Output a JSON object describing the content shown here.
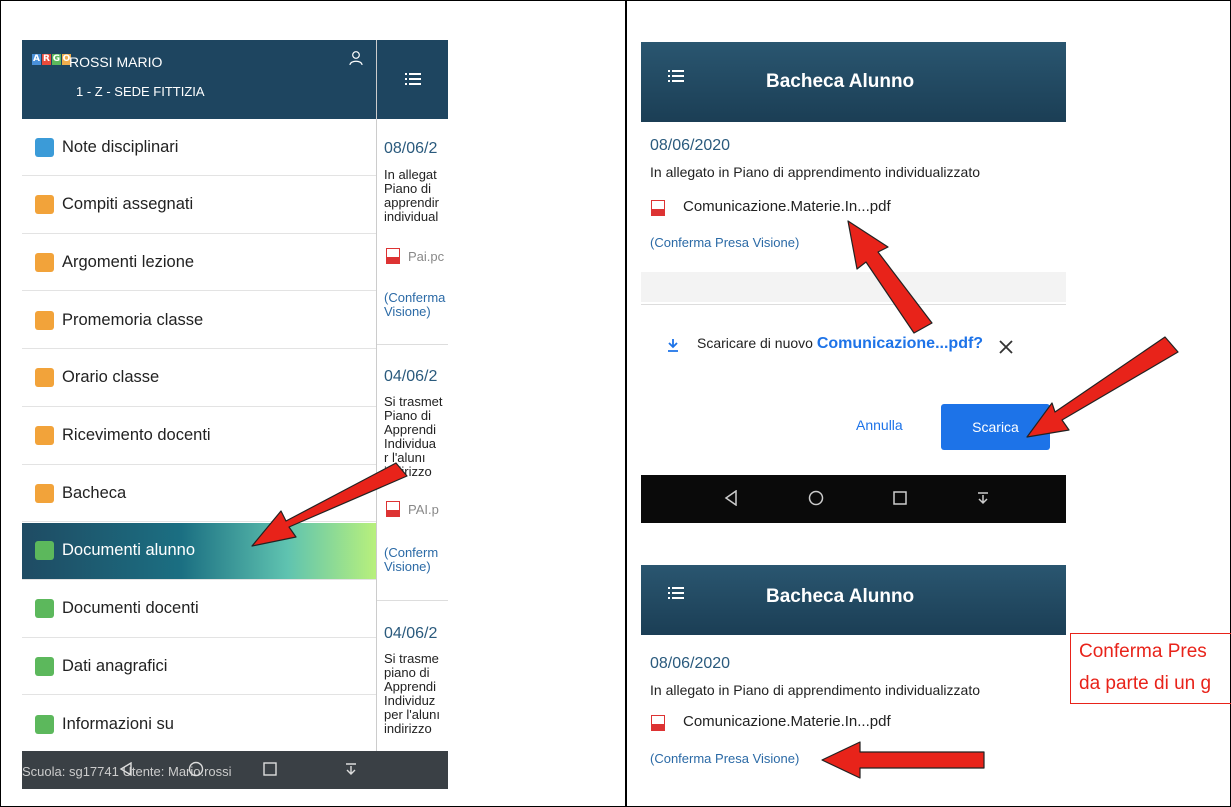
{
  "left_phone": {
    "app_logo_letters": [
      "A",
      "R",
      "G",
      "O"
    ],
    "user_name": "ROSSI MARIO",
    "user_class": "1 - Z - SEDE FITTIZIA",
    "menu": [
      {
        "label": "Note disciplinari",
        "icon": "notes-icon",
        "color": "#3b9bd8"
      },
      {
        "label": "Compiti assegnati",
        "icon": "homework-icon",
        "color": "#f2a33a"
      },
      {
        "label": "Argomenti lezione",
        "icon": "lesson-topics-icon",
        "color": "#f2a33a"
      },
      {
        "label": "Promemoria classe",
        "icon": "reminder-icon",
        "color": "#f2a33a"
      },
      {
        "label": "Orario classe",
        "icon": "timetable-icon",
        "color": "#f2a33a"
      },
      {
        "label": "Ricevimento docenti",
        "icon": "teacher-meeting-icon",
        "color": "#f2a33a"
      },
      {
        "label": "Bacheca",
        "icon": "noticeboard-icon",
        "color": "#f2a33a"
      },
      {
        "label": "Documenti alunno",
        "icon": "student-documents-icon",
        "color": "#5cb85c",
        "active": true
      },
      {
        "label": "Documenti docenti",
        "icon": "teacher-documents-icon",
        "color": "#5cb85c"
      },
      {
        "label": "Dati anagrafici",
        "icon": "personal-data-icon",
        "color": "#5cb85c"
      },
      {
        "label": "Informazioni su",
        "icon": "info-icon",
        "color": "#5cb85c"
      }
    ],
    "status_bar": "Scuola: sg17741 Utente: Mario.rossi",
    "peek": {
      "date1": "08/06/2",
      "text1": [
        "In allegat",
        "Piano di",
        "apprendir",
        "individual"
      ],
      "file1": "Pai.pc",
      "link1": [
        "(Conferma",
        "Visione)"
      ],
      "date2": "04/06/2",
      "text2": [
        "Si trasmet",
        "Piano di",
        "Apprendi",
        "Individua",
        "r l'alunı",
        "indirizzo"
      ],
      "file2": "PAI.p",
      "link2": [
        "(Conferm",
        "Visione)"
      ],
      "date3": "04/06/2",
      "text3": [
        "Si trasme",
        "piano di",
        "Apprendi",
        "Individuz",
        "per l'alunı",
        "indirizzo"
      ]
    }
  },
  "top_right": {
    "header_title": "Bacheca Alunno",
    "date": "08/06/2020",
    "text": "In allegato in Piano di apprendimento individualizzato",
    "file": "Comunicazione.Materie.In...pdf",
    "link": "(Conferma Presa Visione)",
    "download_prompt_prefix": "Scaricare di nuovo",
    "download_prompt_file": "Comunicazione...pdf?",
    "cancel_label": "Annulla",
    "download_label": "Scarica"
  },
  "bottom_right": {
    "header_title": "Bacheca Alunno",
    "date": "08/06/2020",
    "text": "In allegato in Piano di apprendimento individualizzato",
    "file": "Comunicazione.Materie.In...pdf",
    "link": "(Conferma Presa Visione)"
  },
  "callout": {
    "line1": "Conferma Pres",
    "line2": "da parte di un g"
  },
  "colors": {
    "header": "#1e4560",
    "arrow": "#e8231a",
    "link": "#2b6aa6",
    "button": "#1d73e8"
  }
}
